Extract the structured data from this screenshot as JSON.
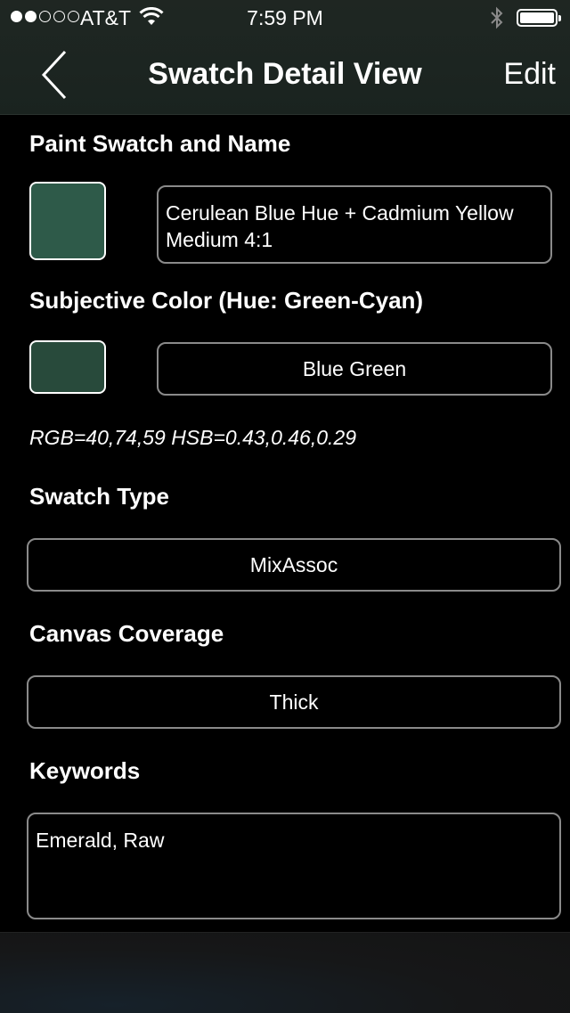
{
  "status_bar": {
    "carrier": "AT&T",
    "time": "7:59 PM",
    "signal_bars_filled": 2,
    "signal_bars_total": 5,
    "battery_level": 1.0,
    "icons": [
      "wifi-icon",
      "bluetooth-icon",
      "battery-icon"
    ]
  },
  "nav": {
    "title": "Swatch Detail View",
    "edit_label": "Edit",
    "back_icon": "chevron-left-icon"
  },
  "paint_swatch": {
    "label": "Paint Swatch and Name",
    "swatch_color": "#2e5a49",
    "name": "Cerulean Blue Hue + Cadmium Yellow Medium 4:1"
  },
  "subjective_color": {
    "label": "Subjective Color (Hue: Green-Cyan)",
    "swatch_color": "#284a3b",
    "value": "Blue Green"
  },
  "rgb_hsb": "RGB=40,74,59 HSB=0.43,0.46,0.29",
  "swatch_type": {
    "label": "Swatch Type",
    "value": "MixAssoc"
  },
  "canvas_coverage": {
    "label": "Canvas Coverage",
    "value": "Thick"
  },
  "keywords": {
    "label": "Keywords",
    "value": "Emerald, Raw"
  },
  "colors": {
    "header_bg": "#1f2622",
    "page_bg": "#000000",
    "field_border": "#8a8a8a"
  }
}
